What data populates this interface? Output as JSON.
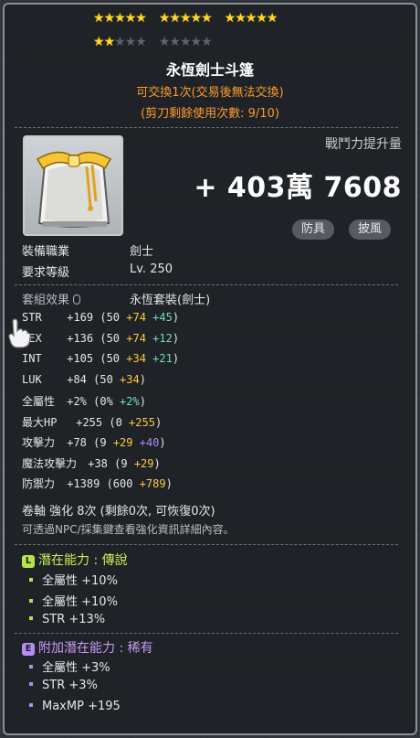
{
  "stars": {
    "filled": 17,
    "total": 25
  },
  "item": {
    "name": "永恆劍士斗篷",
    "trade_note": "可交換1次(交易後無法交換)",
    "scissors_note": "(剪刀剩餘使用次數: 9/10)",
    "power_label": "戰鬥力提升量",
    "power_value": "+ 403萬 7608",
    "tags": [
      "防具",
      "披風"
    ]
  },
  "requirements": {
    "job_label": "裝備職業",
    "job_value": "劍士",
    "level_label": "要求等級",
    "level_value": "Lv. 250"
  },
  "set_effect": {
    "label": "套組效果",
    "value": "永恆套裝(劍士)"
  },
  "stats": [
    {
      "name": "STR",
      "total": "+169",
      "base": "50",
      "add1": "+74",
      "add2": "+45",
      "c1": "y",
      "c2": "g"
    },
    {
      "name": "DEX",
      "total": "+136",
      "base": "50",
      "add1": "+74",
      "add2": "+12",
      "c1": "y",
      "c2": "g"
    },
    {
      "name": "INT",
      "total": "+105",
      "base": "50",
      "add1": "+34",
      "add2": "+21",
      "c1": "y",
      "c2": "g"
    },
    {
      "name": "LUK",
      "total": "+84",
      "base": "50",
      "add1": "+34",
      "add2": "",
      "c1": "y",
      "c2": "g"
    },
    {
      "name": "全屬性",
      "total": "+2%",
      "base": "0%",
      "add1": "+2%",
      "add2": "",
      "c1": "g",
      "c2": "g"
    },
    {
      "name": "最大HP",
      "total": "+255",
      "base": "0",
      "add1": "+255",
      "add2": "",
      "c1": "y",
      "c2": "g"
    },
    {
      "name": "攻擊力",
      "total": "+78",
      "base": "9",
      "add1": "+29",
      "add2": "+40",
      "c1": "y",
      "c2": "p"
    },
    {
      "name": "魔法攻擊力",
      "total": "+38",
      "base": "9",
      "add1": "+29",
      "add2": "",
      "c1": "y",
      "c2": "g"
    },
    {
      "name": "防禦力",
      "total": "+1389",
      "base": "600",
      "add1": "+789",
      "add2": "",
      "c1": "y",
      "c2": "g"
    }
  ],
  "scroll": {
    "line": "卷軸 強化 8次 (剩餘0次, 可恢復0次)",
    "hint": "可透過NPC/採集鍵查看強化資訊詳細內容。"
  },
  "potential": {
    "badge": "L",
    "title": "潛在能力 : 傳說",
    "lines": [
      "全屬性 +10%",
      "全屬性 +10%",
      "STR +13%"
    ]
  },
  "bonus_potential": {
    "badge": "E",
    "title": "附加潛在能力 : 稀有",
    "lines": [
      "全屬性 +3%",
      "STR +3%",
      "MaxMP +195"
    ]
  },
  "colors": {
    "legend": "#b7e24a",
    "epic": "#b58df0",
    "star": "#ffd62a",
    "orange": "#ff9a2e"
  }
}
